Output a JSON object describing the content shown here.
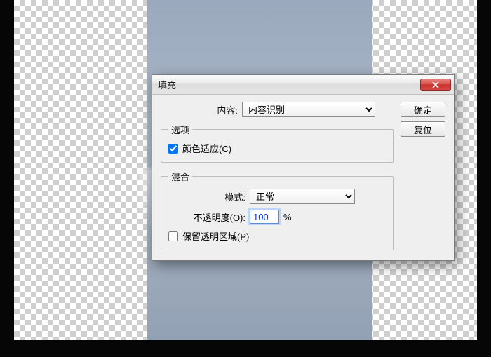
{
  "dialog": {
    "title": "填充",
    "content_label": "内容:",
    "content_value": "内容识别",
    "options_legend": "选项",
    "color_adapt_label": "颜色适应(C)",
    "color_adapt_checked": true,
    "blend_legend": "混合",
    "mode_label": "模式:",
    "mode_value": "正常",
    "opacity_label": "不透明度(O):",
    "opacity_value": "100",
    "percent": "%",
    "preserve_label": "保留透明区域(P)",
    "preserve_checked": false,
    "ok_label": "确定",
    "reset_label": "复位"
  }
}
